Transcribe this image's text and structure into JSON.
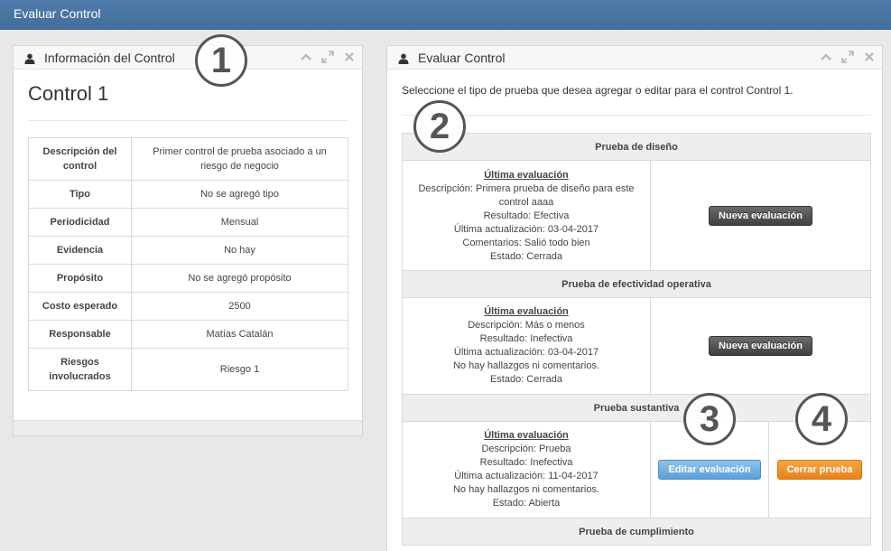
{
  "app": {
    "title": "Evaluar Control"
  },
  "info_widget": {
    "title": "Información del Control",
    "control_name": "Control 1",
    "rows": [
      {
        "label": "Descripción del control",
        "value": "Primer control de prueba asociado a un riesgo de negocio"
      },
      {
        "label": "Tipo",
        "value": "No se agregó tipo"
      },
      {
        "label": "Periodicidad",
        "value": "Mensual"
      },
      {
        "label": "Evidencia",
        "value": "No hay"
      },
      {
        "label": "Propósito",
        "value": "No se agregó propósito"
      },
      {
        "label": "Costo esperado",
        "value": "2500"
      },
      {
        "label": "Responsable",
        "value": "Matías Catalán"
      },
      {
        "label": "Riesgos involucrados",
        "value": "Riesgo 1"
      }
    ]
  },
  "eval_widget": {
    "title": "Evaluar Control",
    "intro": "Seleccione el tipo de prueba que desea agregar o editar para el control Control 1.",
    "sections": [
      {
        "name": "Prueba de diseño",
        "heading": "Última evaluación",
        "lines": [
          "Descripción: Primera prueba de diseño para este control aaaa",
          "Resultado: Efectiva",
          "Última actualización: 03-04-2017",
          "Comentarios: Salió todo bien",
          "Estado: Cerrada"
        ],
        "button": "Nueva evaluación"
      },
      {
        "name": "Prueba de efectividad operativa",
        "heading": "Última evaluación",
        "lines": [
          "Descripción: Más o menos",
          "Resultado: Inefectiva",
          "Última actualización: 03-04-2017",
          "No hay hallazgos ni comentarios.",
          "Estado: Cerrada"
        ],
        "button": "Nueva evaluación"
      },
      {
        "name": "Prueba sustantiva",
        "heading": "Última evaluación",
        "lines": [
          "Descripción: Prueba",
          "Resultado: Inefectiva",
          "Última actualización: 11-04-2017",
          "No hay hallazgos ni comentarios.",
          "Estado: Abierta"
        ],
        "edit_button": "Editar evaluación",
        "close_button": "Cerrar prueba"
      },
      {
        "name": "Prueba de cumplimiento"
      }
    ]
  },
  "annotations": [
    "1",
    "2",
    "3",
    "4"
  ],
  "colors": {
    "topbar": "#4a77a3",
    "btn_dark": "#4a4a4a",
    "btn_info": "#6fb3e0",
    "btn_warning": "#f0901f"
  }
}
